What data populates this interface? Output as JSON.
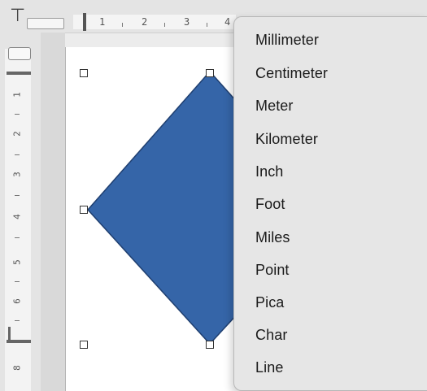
{
  "ruler_top": {
    "numbers": [
      "1",
      "2",
      "3",
      "4"
    ]
  },
  "ruler_left": {
    "numbers": [
      "1",
      "2",
      "3",
      "4",
      "5",
      "6",
      "8"
    ]
  },
  "shape": {
    "fill_color": "#3565a8",
    "stroke_color": "#1f3f70"
  },
  "unit_menu": {
    "items": [
      {
        "label": "Millimeter"
      },
      {
        "label": "Centimeter"
      },
      {
        "label": "Meter"
      },
      {
        "label": "Kilometer"
      },
      {
        "label": "Inch"
      },
      {
        "label": "Foot"
      },
      {
        "label": "Miles"
      },
      {
        "label": "Point"
      },
      {
        "label": "Pica"
      },
      {
        "label": "Char"
      },
      {
        "label": "Line"
      }
    ]
  }
}
